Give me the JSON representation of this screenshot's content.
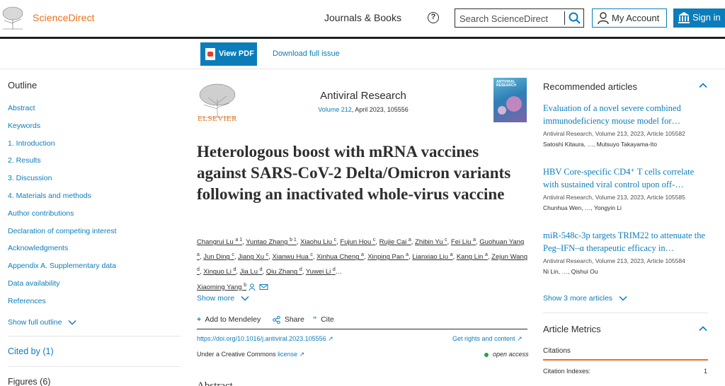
{
  "header": {
    "brand": "ScienceDirect",
    "journals_books": "Journals & Books",
    "search_placeholder": "Search ScienceDirect",
    "my_account": "My Account",
    "sign_in": "Sign in"
  },
  "toolbar": {
    "view_pdf": "View PDF",
    "download_issue": "Download full issue"
  },
  "outline": {
    "title": "Outline",
    "items": [
      "Abstract",
      "Keywords",
      "1. Introduction",
      "2. Results",
      "3. Discussion",
      "4. Materials and methods",
      "Author contributions",
      "Declaration of competing interest",
      "Acknowledgments",
      "Appendix A. Supplementary data",
      "Data availability",
      "References"
    ],
    "show_full": "Show full outline",
    "cited_by": "Cited by (1)",
    "figures": "Figures (6)"
  },
  "article": {
    "publisher": "ELSEVIER",
    "journal": "Antiviral Research",
    "volume": "Volume 212",
    "issue_info": ", April 2023, 105556",
    "cover_text": "ANTIVIRAL RESEARCH",
    "title": "Heterologous boost with mRNA vaccines against SARS-CoV-2 Delta/Omicron variants following an inactivated whole-virus vaccine",
    "authors": [
      {
        "name": "Changrui Lu",
        "sup": "a 1"
      },
      {
        "name": "Yuntao Zhang",
        "sup": "b 1"
      },
      {
        "name": "Xiaohu Liu",
        "sup": "c"
      },
      {
        "name": "Fujun Hou",
        "sup": "c"
      },
      {
        "name": "Rujie Cai",
        "sup": "a"
      },
      {
        "name": "Zhibin Yu",
        "sup": "c"
      },
      {
        "name": "Fei Liu",
        "sup": "a"
      },
      {
        "name": "Guohuan Yang",
        "sup": "a"
      },
      {
        "name": "Jun Ding",
        "sup": "c"
      },
      {
        "name": "Jiang Xu",
        "sup": "c"
      },
      {
        "name": "Xianwu Hua",
        "sup": "c"
      },
      {
        "name": "Xinhua Cheng",
        "sup": "a"
      },
      {
        "name": "Xinping Pan",
        "sup": "a"
      },
      {
        "name": "Lianxiao Liu",
        "sup": "a"
      },
      {
        "name": "Kang Lin",
        "sup": "a"
      },
      {
        "name": "Zejun Wang",
        "sup": "d"
      },
      {
        "name": "Xinguo Li",
        "sup": "d"
      },
      {
        "name": "Jia Lu",
        "sup": "d"
      },
      {
        "name": "Qiu Zhang",
        "sup": "d"
      },
      {
        "name": "Yuwei Li",
        "sup": "d"
      },
      {
        "name": "Xiaoming Yang",
        "sup": "b"
      }
    ],
    "ellipsis": "…",
    "show_more": "Show more",
    "add_mendeley": "Add to Mendeley",
    "share": "Share",
    "cite": "Cite",
    "doi": "https://doi.org/10.1016/j.antiviral.2023.105556",
    "rights": "Get rights and content",
    "cc_prefix": "Under a Creative Commons",
    "cc_license": "license",
    "open_access": "open access",
    "abstract_heading": "Abstract"
  },
  "recommended": {
    "title": "Recommended articles",
    "items": [
      {
        "title": "Evaluation of a novel severe combined immunodeficiency mouse model for…",
        "source": "Antiviral Research, Volume 213, 2023, Article 105582",
        "authors": "Satoshi Kitaura, …, Mutsuyo Takayama-Ito"
      },
      {
        "title": "HBV Core-specific CD4⁺ T cells correlate with sustained viral control upon off-…",
        "source": "Antiviral Research, Volume 213, 2023, Article 105585",
        "authors": "Chunhua Wen, …, Yongyin Li"
      },
      {
        "title": "miR-548c-3p targets TRIM22 to attenuate the Peg–IFN–α therapeutic efficacy in…",
        "source": "Antiviral Research, Volume 213, 2023, Article 105584",
        "authors": "Ni Lin, …, Qishui Ou"
      }
    ],
    "show_more": "Show 3 more articles"
  },
  "metrics": {
    "title": "Article Metrics",
    "citations_tab": "Citations",
    "citation_indexes_label": "Citation Indexes:",
    "citation_indexes_value": "1"
  },
  "colors": {
    "accent": "#0c7dbb",
    "brand_orange": "#e9711c",
    "open_access_green": "#22a34a"
  }
}
